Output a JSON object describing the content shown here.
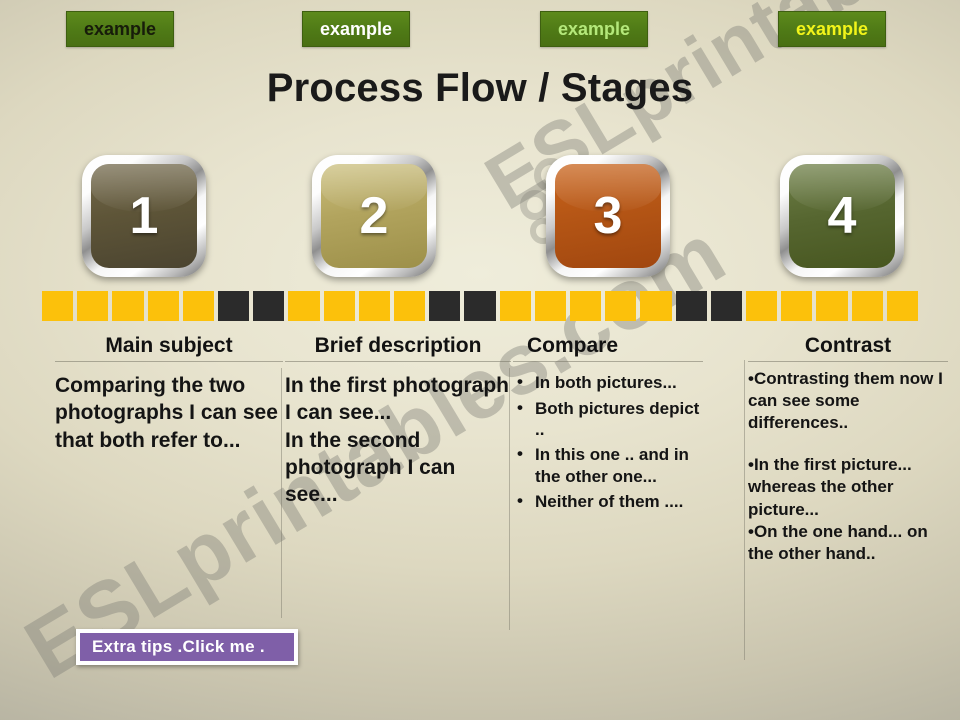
{
  "slide": {
    "title": "Process Flow / Stages",
    "watermark": "ESLprintables.com"
  },
  "example_buttons": [
    {
      "label": "example",
      "text_color": "#171c0a",
      "bg_color": "#4f7a16"
    },
    {
      "label": "example",
      "text_color": "#ffffff",
      "bg_color": "#4f7a16"
    },
    {
      "label": "example",
      "text_color": "#b4e87a",
      "bg_color": "#4f7a16"
    },
    {
      "label": "example",
      "text_color": "#f2f41a",
      "bg_color": "#4f7a16"
    }
  ],
  "stages": [
    {
      "number": "1",
      "color": "#5e5538"
    },
    {
      "number": "2",
      "color": "#b2a45e"
    },
    {
      "number": "3",
      "color": "#b45515"
    },
    {
      "number": "4",
      "color": "#566630"
    }
  ],
  "divider_bar": {
    "yellow": "#fcc10b",
    "dark": "#2b2b2b",
    "pattern": [
      "y",
      "y",
      "y",
      "y",
      "y",
      "d",
      "d",
      "y",
      "y",
      "y",
      "y",
      "d",
      "d",
      "y",
      "y",
      "y",
      "y",
      "y",
      "d",
      "d",
      "y",
      "y",
      "y",
      "y",
      "y"
    ]
  },
  "columns": [
    {
      "heading": "Main subject",
      "paragraphs": [
        "Comparing the two photographs I can see that both refer to..."
      ]
    },
    {
      "heading": "Brief description",
      "paragraphs": [
        "In the first photograph I can see...",
        "In the second photograph I can see..."
      ]
    },
    {
      "heading": "Compare",
      "bullets": [
        "In both pictures...",
        "Both pictures depict ..",
        "In this one .. and in the other one...",
        "Neither of them ...."
      ]
    },
    {
      "heading": "Contrast",
      "paragraphs": [
        "•Contrasting them now I can see some differences..",
        "•In the first picture... whereas the other picture...",
        "•On the one hand... on the other hand.."
      ]
    }
  ],
  "tips_button": {
    "label": "Extra tips .Click me ."
  }
}
